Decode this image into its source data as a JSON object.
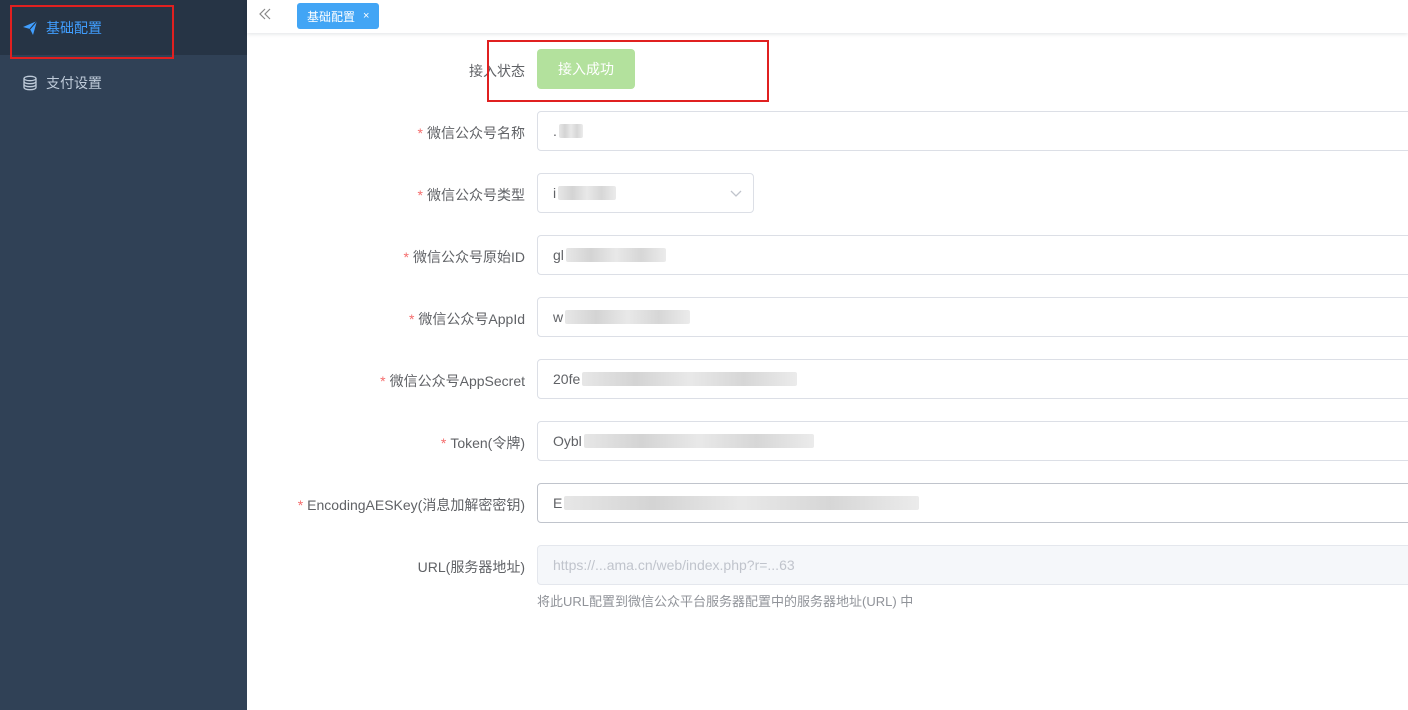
{
  "sidebar": {
    "items": [
      {
        "label": "基础配置",
        "icon": "paper-plane-icon",
        "active": true
      },
      {
        "label": "支付设置",
        "icon": "database-icon",
        "active": false
      }
    ]
  },
  "topbar": {
    "collapse_icon": "double-chevron-left-icon",
    "tabs": [
      {
        "label": "基础配置",
        "close": "×"
      }
    ]
  },
  "form": {
    "status": {
      "label": "接入状态",
      "button": "接入成功"
    },
    "mp_name": {
      "label": "微信公众号名称",
      "value": "."
    },
    "mp_type": {
      "label": "微信公众号类型",
      "value": "i"
    },
    "mp_original_id": {
      "label": "微信公众号原始ID",
      "value": "gl"
    },
    "mp_appid": {
      "label": "微信公众号AppId",
      "value": "w"
    },
    "mp_appsecret": {
      "label": "微信公众号AppSecret",
      "value": "20fe"
    },
    "token": {
      "label": "Token(令牌)",
      "value": "Oybl"
    },
    "aes_key": {
      "label": "EncodingAESKey(消息加解密密钥)",
      "value": "E"
    },
    "url": {
      "label": "URL(服务器地址)",
      "value": "https://...ama.cn/web/index.php?r=...63",
      "hint": "将此URL配置到微信公众平台服务器配置中的服务器地址(URL) 中"
    },
    "required_mark": "*"
  },
  "colors": {
    "sidebar_bg": "#304156",
    "accent": "#409eff",
    "success_light": "#b3e19d",
    "required": "#f56c6c"
  }
}
